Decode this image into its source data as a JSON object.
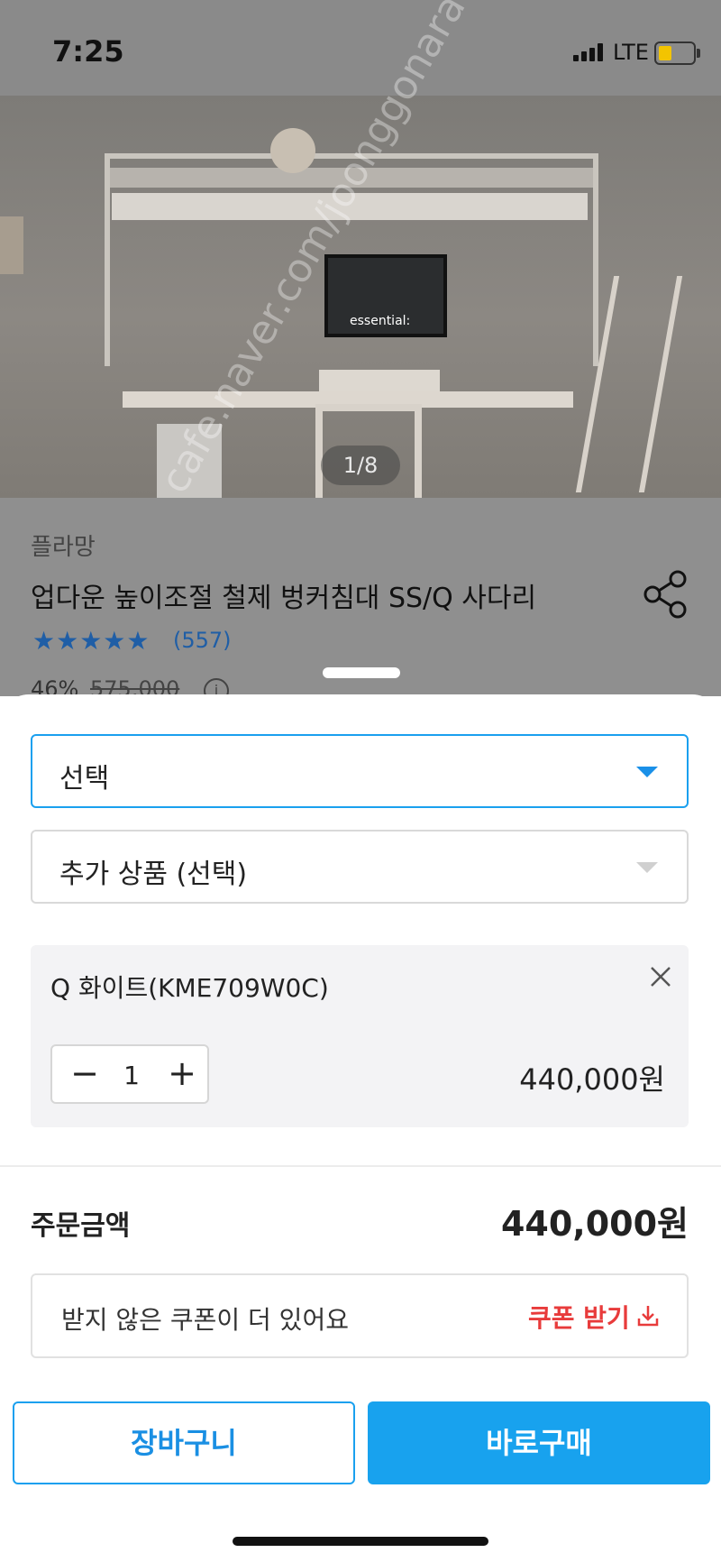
{
  "status": {
    "time": "7:25",
    "network": "LTE"
  },
  "gallery": {
    "counter": "1/8",
    "monitor_text": "essential:"
  },
  "product": {
    "brand": "플라망",
    "title": "업다운 높이조절 철제 벙커침대 SS/Q 사다리",
    "rating_stars": "★★★★★",
    "review_count": "(557)",
    "discount_rate": "46%",
    "original_price": "575,000",
    "rating_color": "#1f5ea6"
  },
  "sheet": {
    "option_select": {
      "label": "선택"
    },
    "addon_select": {
      "label": "추가 상품 (선택)"
    },
    "selected_item": {
      "name": "Q 화이트(KME709W0C)",
      "quantity": "1",
      "price": "440,000원"
    },
    "order_total_label": "주문금액",
    "order_total_value": "440,000원",
    "coupon_text": "받지 않은 쿠폰이 더 있어요",
    "coupon_button": "쿠폰 받기",
    "cart_button": "장바구니",
    "buy_now_button": "바로구매",
    "accent_color": "#18a2ee",
    "coupon_color": "#e83b3b"
  },
  "watermark": {
    "line1": "cafe.naver.com/joonggonara",
    "line2": "joonggonara"
  },
  "icons": {
    "share": "share-icon",
    "remove": "close-icon",
    "download": "download-icon",
    "info": "info-icon",
    "chevron": "chevron-down-icon"
  }
}
